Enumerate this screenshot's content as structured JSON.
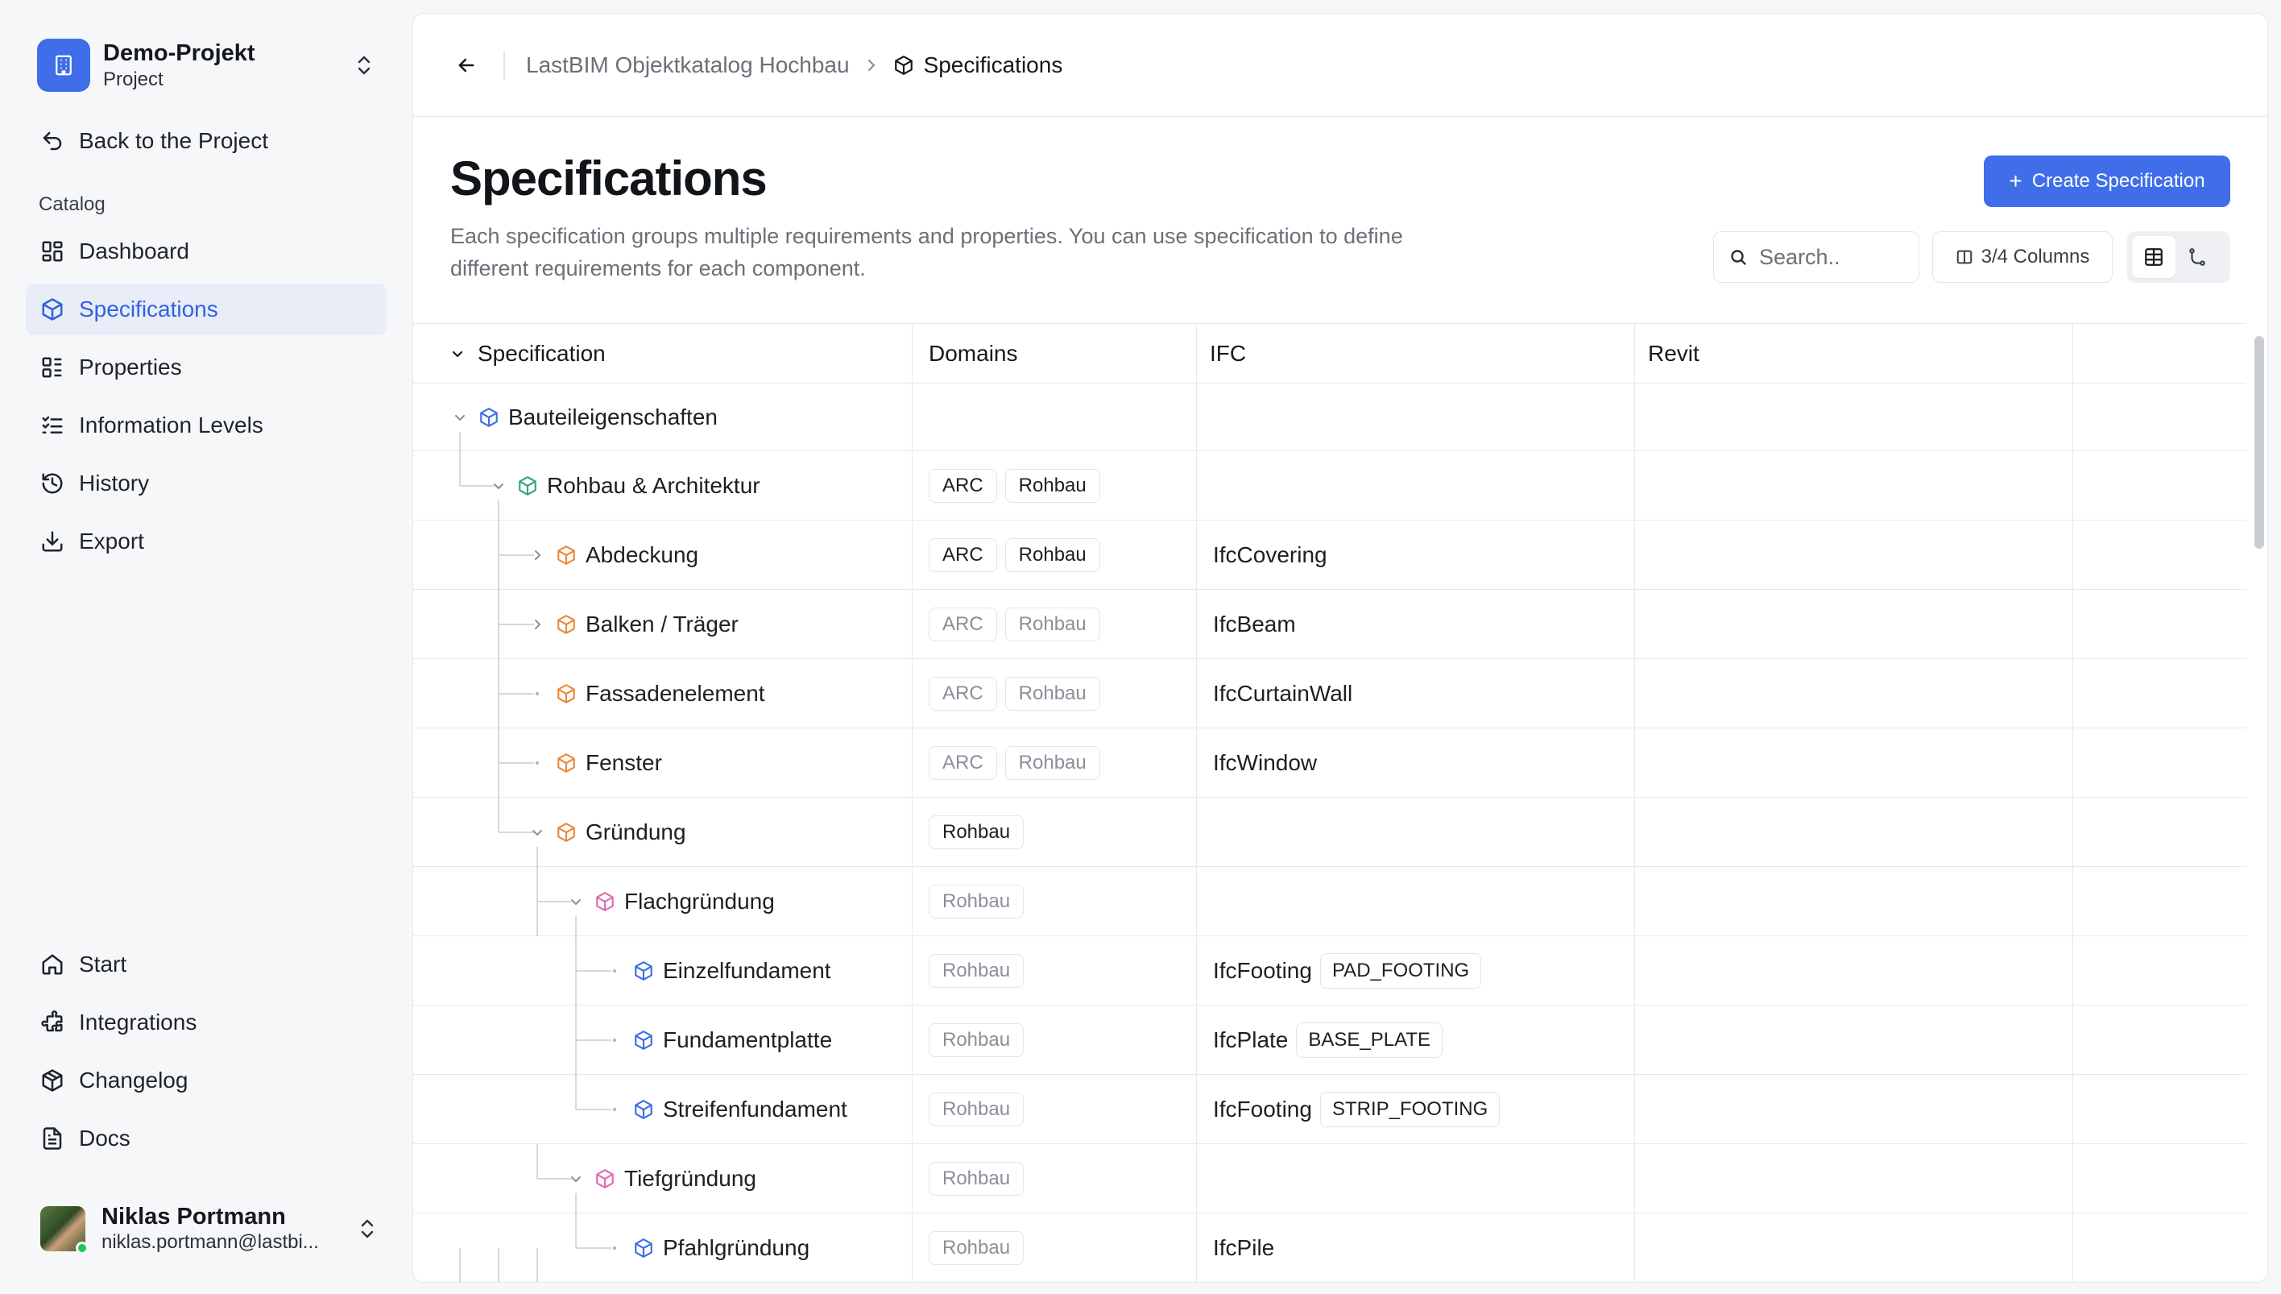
{
  "sidebar": {
    "project": {
      "name": "Demo-Projekt",
      "subtitle": "Project"
    },
    "back_label": "Back to the Project",
    "section_label": "Catalog",
    "catalog_items": [
      {
        "label": "Dashboard",
        "icon": "dashboard-icon",
        "active": false
      },
      {
        "label": "Specifications",
        "icon": "cube-icon",
        "active": true
      },
      {
        "label": "Properties",
        "icon": "list-icon",
        "active": false
      },
      {
        "label": "Information Levels",
        "icon": "checklist-icon",
        "active": false
      },
      {
        "label": "History",
        "icon": "history-icon",
        "active": false
      },
      {
        "label": "Export",
        "icon": "download-icon",
        "active": false
      }
    ],
    "bottom_items": [
      {
        "label": "Start",
        "icon": "home-icon"
      },
      {
        "label": "Integrations",
        "icon": "puzzle-icon"
      },
      {
        "label": "Changelog",
        "icon": "box-icon"
      },
      {
        "label": "Docs",
        "icon": "document-icon"
      }
    ],
    "user": {
      "name": "Niklas Portmann",
      "email": "niklas.portmann@lastbi..."
    }
  },
  "breadcrumb": {
    "parent": "LastBIM Objektkatalog Hochbau",
    "current": "Specifications"
  },
  "page": {
    "title": "Specifications",
    "description": "Each specification groups multiple requirements and properties. You can use specification to define different requirements for each component.",
    "create_label": "Create Specification",
    "search_placeholder": "Search..",
    "columns_label": "3/4 Columns"
  },
  "colors": {
    "accent": "#3f6ee8",
    "cube_blue": "#3f6ee8",
    "cube_green": "#33a384",
    "cube_orange": "#ea8a3c",
    "cube_pink": "#e16bb0"
  },
  "table": {
    "headers": {
      "spec": "Specification",
      "domains": "Domains",
      "ifc": "IFC",
      "revit": "Revit"
    },
    "rows": [
      {
        "name": "Bauteileigenschaften",
        "level": 0,
        "chevron": "down",
        "cube": "blue",
        "domains": [],
        "dim": false,
        "ifc": "",
        "ifc_enum": ""
      },
      {
        "name": "Rohbau & Architektur",
        "level": 1,
        "chevron": "down",
        "cube": "green",
        "domains": [
          "ARC",
          "Rohbau"
        ],
        "dim": false,
        "ifc": "",
        "ifc_enum": ""
      },
      {
        "name": "Abdeckung",
        "level": 2,
        "chevron": "right",
        "cube": "orange",
        "domains": [
          "ARC",
          "Rohbau"
        ],
        "dim": false,
        "ifc": "IfcCovering",
        "ifc_enum": ""
      },
      {
        "name": "Balken / Träger",
        "level": 2,
        "chevron": "right",
        "cube": "orange",
        "domains": [
          "ARC",
          "Rohbau"
        ],
        "dim": true,
        "ifc": "IfcBeam",
        "ifc_enum": ""
      },
      {
        "name": "Fassadenelement",
        "level": 2,
        "chevron": "none",
        "cube": "orange",
        "domains": [
          "ARC",
          "Rohbau"
        ],
        "dim": true,
        "ifc": "IfcCurtainWall",
        "ifc_enum": ""
      },
      {
        "name": "Fenster",
        "level": 2,
        "chevron": "none",
        "cube": "orange",
        "domains": [
          "ARC",
          "Rohbau"
        ],
        "dim": true,
        "ifc": "IfcWindow",
        "ifc_enum": ""
      },
      {
        "name": "Gründung",
        "level": 2,
        "chevron": "down",
        "cube": "orange",
        "domains": [
          "Rohbau"
        ],
        "dim": false,
        "ifc": "",
        "ifc_enum": ""
      },
      {
        "name": "Flachgründung",
        "level": 3,
        "chevron": "down",
        "cube": "pink",
        "domains": [
          "Rohbau"
        ],
        "dim": true,
        "ifc": "",
        "ifc_enum": ""
      },
      {
        "name": "Einzelfundament",
        "level": 4,
        "chevron": "none",
        "cube": "blue",
        "domains": [
          "Rohbau"
        ],
        "dim": true,
        "ifc": "IfcFooting",
        "ifc_enum": "PAD_FOOTING"
      },
      {
        "name": "Fundamentplatte",
        "level": 4,
        "chevron": "none",
        "cube": "blue",
        "domains": [
          "Rohbau"
        ],
        "dim": true,
        "ifc": "IfcPlate",
        "ifc_enum": "BASE_PLATE"
      },
      {
        "name": "Streifenfundament",
        "level": 4,
        "chevron": "none",
        "cube": "blue",
        "domains": [
          "Rohbau"
        ],
        "dim": true,
        "ifc": "IfcFooting",
        "ifc_enum": "STRIP_FOOTING"
      },
      {
        "name": "Tiefgründung",
        "level": 3,
        "chevron": "down",
        "cube": "pink",
        "domains": [
          "Rohbau"
        ],
        "dim": true,
        "ifc": "",
        "ifc_enum": ""
      },
      {
        "name": "Pfahlgründung",
        "level": 4,
        "chevron": "none",
        "cube": "blue",
        "domains": [
          "Rohbau"
        ],
        "dim": true,
        "ifc": "IfcPile",
        "ifc_enum": ""
      }
    ]
  }
}
